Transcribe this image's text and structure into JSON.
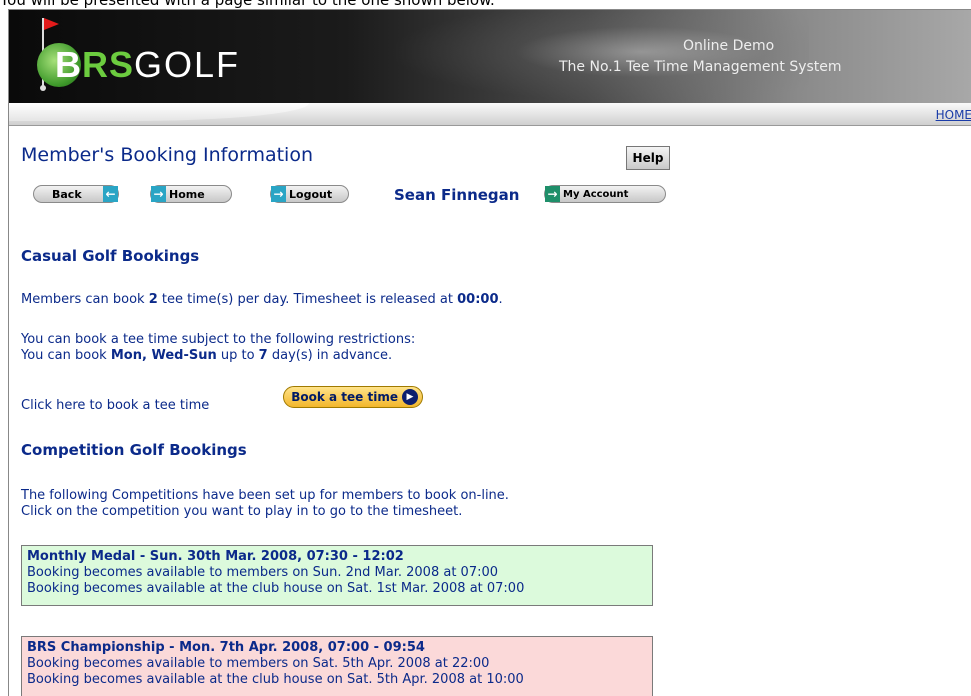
{
  "intro": "You will be presented with a page similar to the one shown below.",
  "banner": {
    "logo": {
      "b": "B",
      "rs": "RS",
      "golf": "GOLF"
    },
    "tagline1": "Online Demo",
    "tagline2": "The No.1 Tee Time Management System"
  },
  "navbar": {
    "home_link": "HOME"
  },
  "page": {
    "title": "Member's Booking Information",
    "help_label": "Help",
    "back_label": "Back",
    "home_label": "Home",
    "logout_label": "Logout",
    "user_name": "Sean Finnegan",
    "account_label": "My Account"
  },
  "casual": {
    "heading": "Casual Golf Bookings",
    "line1_pre": "Members can book ",
    "line1_num": "2",
    "line1_mid": " tee time(s) per day. Timesheet is released at ",
    "line1_time": "00:00",
    "line1_end": ".",
    "restrict1": "You can book a tee time subject to the following restrictions:",
    "restrict2_pre": "You can book ",
    "restrict2_days": "Mon, Wed-Sun",
    "restrict2_mid": " up to ",
    "restrict2_num": "7",
    "restrict2_end": " day(s) in advance.",
    "click_text": "Click here to book a tee time",
    "book_button": "Book a tee time"
  },
  "competition": {
    "heading": "Competition Golf Bookings",
    "intro1": "The following Competitions have been set up for members to book on-line.",
    "intro2": "Click on the competition you want to play in to go to the timesheet.",
    "items": [
      {
        "title": "Monthly Medal  -  Sun. 30th Mar. 2008,  07:30 - 12:02",
        "line1": "Booking becomes available to members on Sun. 2nd Mar. 2008 at 07:00",
        "line2": "Booking becomes available at the club house on Sat. 1st Mar. 2008 at 07:00",
        "color": "#dcfadc"
      },
      {
        "title": "BRS Championship  -  Mon. 7th Apr. 2008,  07:00 - 09:54",
        "line1": "Booking becomes available to members on Sat. 5th Apr. 2008 at 22:00",
        "line2": "Booking becomes available at the club house on Sat. 5th Apr. 2008 at 10:00",
        "color": "#fbd9d9"
      }
    ]
  }
}
